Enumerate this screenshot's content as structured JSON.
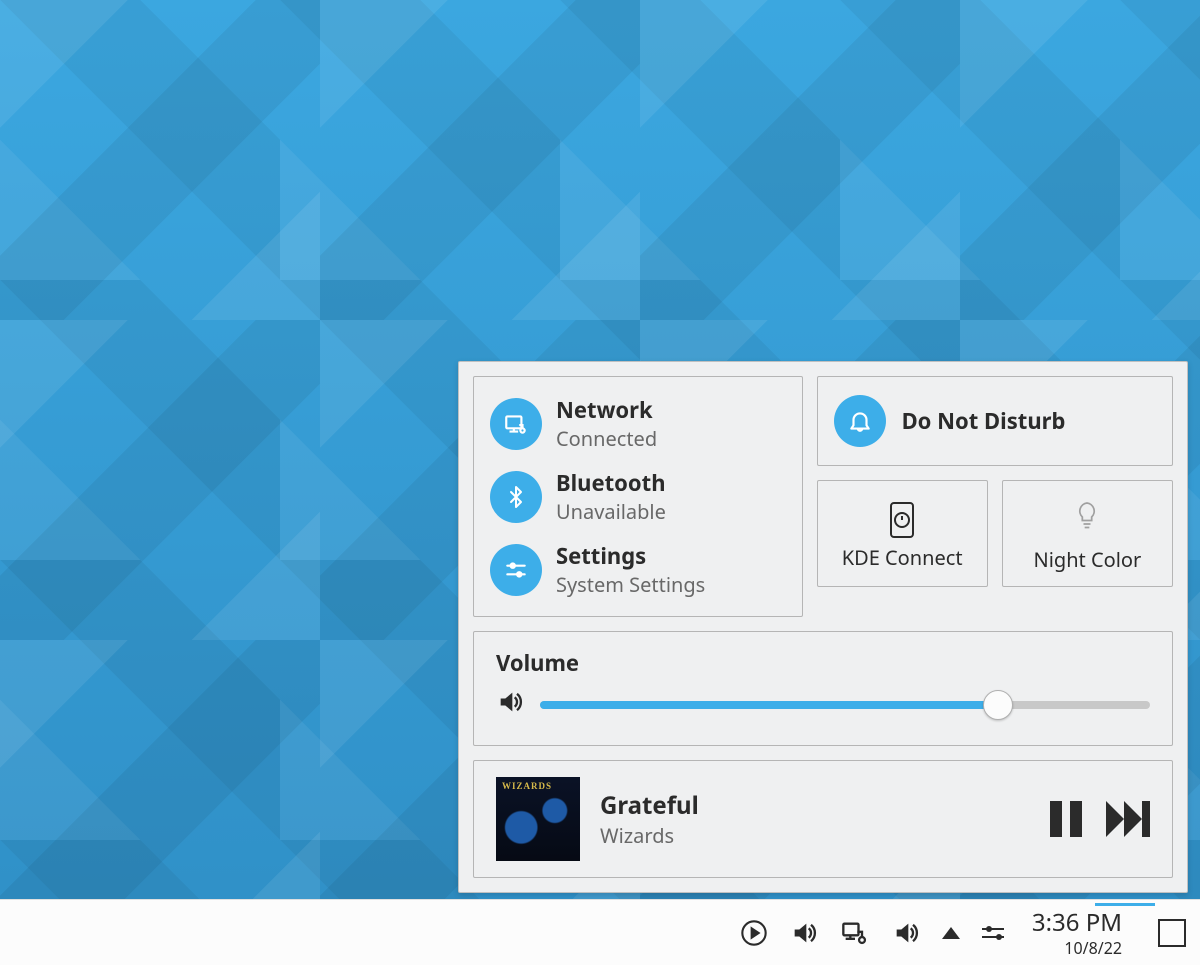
{
  "quick_settings": {
    "network": {
      "title": "Network",
      "status": "Connected"
    },
    "bluetooth": {
      "title": "Bluetooth",
      "status": "Unavailable"
    },
    "settings": {
      "title": "Settings",
      "status": "System Settings"
    },
    "dnd": {
      "title": "Do Not Disturb"
    },
    "kde_connect": {
      "label": "KDE Connect"
    },
    "night_color": {
      "label": "Night Color"
    }
  },
  "volume": {
    "label": "Volume",
    "percent": 75
  },
  "media": {
    "track": "Grateful",
    "artist": "Wizards"
  },
  "taskbar": {
    "time": "3:36 PM",
    "date": "10/8/22"
  },
  "colors": {
    "accent": "#3daee9"
  }
}
